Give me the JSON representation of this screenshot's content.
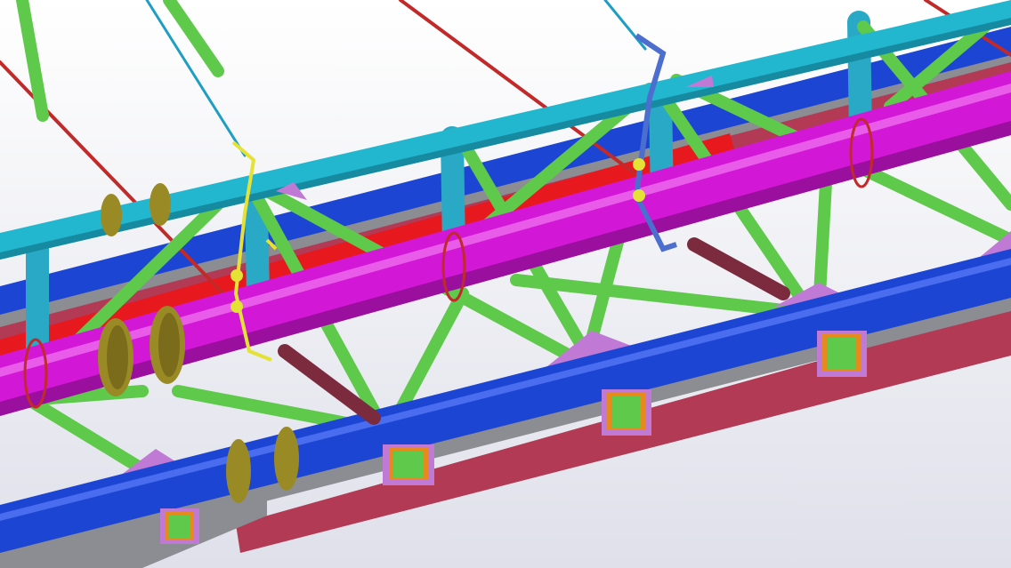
{
  "colors": {
    "background_top": "#ffffff",
    "background_bottom": "#dfe0ea",
    "top_chord": "#23b6cf",
    "diagonal_web": "#5ec94a",
    "vertical_post": "#2aa9c6",
    "main_pipe": "#d317d6",
    "lower_chord": "#1d45d4",
    "red_pipe": "#e8181f",
    "maroon_beam": "#b23a55",
    "gray_frame": "#8b8d92",
    "gusset_plate": "#c07ad6",
    "hanger_cable": "#c22a2a",
    "hanger_rod_cyan": "#1e9ec2",
    "clamp_yellow": "#e5e236",
    "flange_olive": "#9a8a25",
    "base_plate_orange": "#e78a1e",
    "clamp_blue": "#4b6ecf"
  }
}
